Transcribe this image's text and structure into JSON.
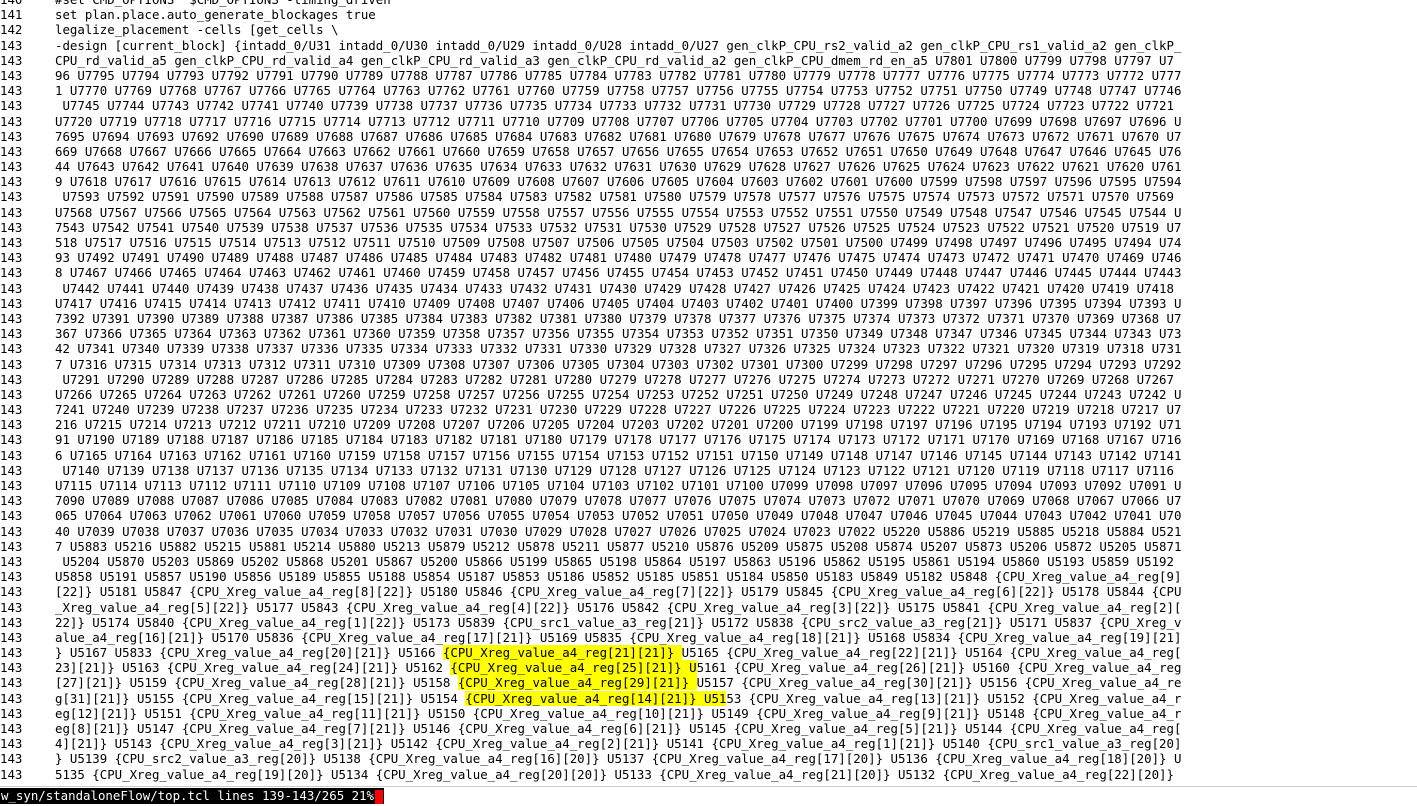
{
  "terminal": {
    "lines": [
      {
        "n": "140",
        "t": "#set CMD_OPTIONS \"$CMD_OPTIONS -timing_driven\""
      },
      {
        "n": "141",
        "t": "set plan.place.auto_generate_blockages true"
      },
      {
        "n": "142",
        "t": "legalize_placement -cells [get_cells \\"
      },
      {
        "n": "143",
        "t": "-design [current_block] {intadd_0/U31 intadd_0/U30 intadd_0/U29 intadd_0/U28 intadd_0/U27 gen_clkP_CPU_rs2_valid_a2 gen_clkP_CPU_rs1_valid_a2 gen_clkP_"
      },
      {
        "n": "143",
        "t": "CPU_rd_valid_a5 gen_clkP_CPU_rd_valid_a4 gen_clkP_CPU_rd_valid_a3 gen_clkP_CPU_rd_valid_a2 gen_clkP_CPU_dmem_rd_en_a5 U7801 U7800 U7799 U7798 U7797 U7"
      },
      {
        "n": "143",
        "t": "96 U7795 U7794 U7793 U7792 U7791 U7790 U7789 U7788 U7787 U7786 U7785 U7784 U7783 U7782 U7781 U7780 U7779 U7778 U7777 U7776 U7775 U7774 U7773 U7772 U777"
      },
      {
        "n": "143",
        "t": "1 U7770 U7769 U7768 U7767 U7766 U7765 U7764 U7763 U7762 U7761 U7760 U7759 U7758 U7757 U7756 U7755 U7754 U7753 U7752 U7751 U7750 U7749 U7748 U7747 U7746"
      },
      {
        "n": "143",
        "t": " U7745 U7744 U7743 U7742 U7741 U7740 U7739 U7738 U7737 U7736 U7735 U7734 U7733 U7732 U7731 U7730 U7729 U7728 U7727 U7726 U7725 U7724 U7723 U7722 U7721"
      },
      {
        "n": "143",
        "t": "U7720 U7719 U7718 U7717 U7716 U7715 U7714 U7713 U7712 U7711 U7710 U7709 U7708 U7707 U7706 U7705 U7704 U7703 U7702 U7701 U7700 U7699 U7698 U7697 U7696 U"
      },
      {
        "n": "143",
        "t": "7695 U7694 U7693 U7692 U7690 U7689 U7688 U7687 U7686 U7685 U7684 U7683 U7682 U7681 U7680 U7679 U7678 U7677 U7676 U7675 U7674 U7673 U7672 U7671 U7670 U7"
      },
      {
        "n": "143",
        "t": "669 U7668 U7667 U7666 U7665 U7664 U7663 U7662 U7661 U7660 U7659 U7658 U7657 U7656 U7655 U7654 U7653 U7652 U7651 U7650 U7649 U7648 U7647 U7646 U7645 U76"
      },
      {
        "n": "143",
        "t": "44 U7643 U7642 U7641 U7640 U7639 U7638 U7637 U7636 U7635 U7634 U7633 U7632 U7631 U7630 U7629 U7628 U7627 U7626 U7625 U7624 U7623 U7622 U7621 U7620 U761"
      },
      {
        "n": "143",
        "t": "9 U7618 U7617 U7616 U7615 U7614 U7613 U7612 U7611 U7610 U7609 U7608 U7607 U7606 U7605 U7604 U7603 U7602 U7601 U7600 U7599 U7598 U7597 U7596 U7595 U7594"
      },
      {
        "n": "143",
        "t": " U7593 U7592 U7591 U7590 U7589 U7588 U7587 U7586 U7585 U7584 U7583 U7582 U7581 U7580 U7579 U7578 U7577 U7576 U7575 U7574 U7573 U7572 U7571 U7570 U7569"
      },
      {
        "n": "143",
        "t": "U7568 U7567 U7566 U7565 U7564 U7563 U7562 U7561 U7560 U7559 U7558 U7557 U7556 U7555 U7554 U7553 U7552 U7551 U7550 U7549 U7548 U7547 U7546 U7545 U7544 U"
      },
      {
        "n": "143",
        "t": "7543 U7542 U7541 U7540 U7539 U7538 U7537 U7536 U7535 U7534 U7533 U7532 U7531 U7530 U7529 U7528 U7527 U7526 U7525 U7524 U7523 U7522 U7521 U7520 U7519 U7"
      },
      {
        "n": "143",
        "t": "518 U7517 U7516 U7515 U7514 U7513 U7512 U7511 U7510 U7509 U7508 U7507 U7506 U7505 U7504 U7503 U7502 U7501 U7500 U7499 U7498 U7497 U7496 U7495 U7494 U74"
      },
      {
        "n": "143",
        "t": "93 U7492 U7491 U7490 U7489 U7488 U7487 U7486 U7485 U7484 U7483 U7482 U7481 U7480 U7479 U7478 U7477 U7476 U7475 U7474 U7473 U7472 U7471 U7470 U7469 U746"
      },
      {
        "n": "143",
        "t": "8 U7467 U7466 U7465 U7464 U7463 U7462 U7461 U7460 U7459 U7458 U7457 U7456 U7455 U7454 U7453 U7452 U7451 U7450 U7449 U7448 U7447 U7446 U7445 U7444 U7443"
      },
      {
        "n": "143",
        "t": " U7442 U7441 U7440 U7439 U7438 U7437 U7436 U7435 U7434 U7433 U7432 U7431 U7430 U7429 U7428 U7427 U7426 U7425 U7424 U7423 U7422 U7421 U7420 U7419 U7418"
      },
      {
        "n": "143",
        "t": "U7417 U7416 U7415 U7414 U7413 U7412 U7411 U7410 U7409 U7408 U7407 U7406 U7405 U7404 U7403 U7402 U7401 U7400 U7399 U7398 U7397 U7396 U7395 U7394 U7393 U"
      },
      {
        "n": "143",
        "t": "7392 U7391 U7390 U7389 U7388 U7387 U7386 U7385 U7384 U7383 U7382 U7381 U7380 U7379 U7378 U7377 U7376 U7375 U7374 U7373 U7372 U7371 U7370 U7369 U7368 U7"
      },
      {
        "n": "143",
        "t": "367 U7366 U7365 U7364 U7363 U7362 U7361 U7360 U7359 U7358 U7357 U7356 U7355 U7354 U7353 U7352 U7351 U7350 U7349 U7348 U7347 U7346 U7345 U7344 U7343 U73"
      },
      {
        "n": "143",
        "t": "42 U7341 U7340 U7339 U7338 U7337 U7336 U7335 U7334 U7333 U7332 U7331 U7330 U7329 U7328 U7327 U7326 U7325 U7324 U7323 U7322 U7321 U7320 U7319 U7318 U731"
      },
      {
        "n": "143",
        "t": "7 U7316 U7315 U7314 U7313 U7312 U7311 U7310 U7309 U7308 U7307 U7306 U7305 U7304 U7303 U7302 U7301 U7300 U7299 U7298 U7297 U7296 U7295 U7294 U7293 U7292"
      },
      {
        "n": "143",
        "t": " U7291 U7290 U7289 U7288 U7287 U7286 U7285 U7284 U7283 U7282 U7281 U7280 U7279 U7278 U7277 U7276 U7275 U7274 U7273 U7272 U7271 U7270 U7269 U7268 U7267"
      },
      {
        "n": "143",
        "t": "U7266 U7265 U7264 U7263 U7262 U7261 U7260 U7259 U7258 U7257 U7256 U7255 U7254 U7253 U7252 U7251 U7250 U7249 U7248 U7247 U7246 U7245 U7244 U7243 U7242 U"
      },
      {
        "n": "143",
        "t": "7241 U7240 U7239 U7238 U7237 U7236 U7235 U7234 U7233 U7232 U7231 U7230 U7229 U7228 U7227 U7226 U7225 U7224 U7223 U7222 U7221 U7220 U7219 U7218 U7217 U7"
      },
      {
        "n": "143",
        "t": "216 U7215 U7214 U7213 U7212 U7211 U7210 U7209 U7208 U7207 U7206 U7205 U7204 U7203 U7202 U7201 U7200 U7199 U7198 U7197 U7196 U7195 U7194 U7193 U7192 U71"
      },
      {
        "n": "143",
        "t": "91 U7190 U7189 U7188 U7187 U7186 U7185 U7184 U7183 U7182 U7181 U7180 U7179 U7178 U7177 U7176 U7175 U7174 U7173 U7172 U7171 U7170 U7169 U7168 U7167 U716"
      },
      {
        "n": "143",
        "t": "6 U7165 U7164 U7163 U7162 U7161 U7160 U7159 U7158 U7157 U7156 U7155 U7154 U7153 U7152 U7151 U7150 U7149 U7148 U7147 U7146 U7145 U7144 U7143 U7142 U7141"
      },
      {
        "n": "143",
        "t": " U7140 U7139 U7138 U7137 U7136 U7135 U7134 U7133 U7132 U7131 U7130 U7129 U7128 U7127 U7126 U7125 U7124 U7123 U7122 U7121 U7120 U7119 U7118 U7117 U7116"
      },
      {
        "n": "143",
        "t": "U7115 U7114 U7113 U7112 U7111 U7110 U7109 U7108 U7107 U7106 U7105 U7104 U7103 U7102 U7101 U7100 U7099 U7098 U7097 U7096 U7095 U7094 U7093 U7092 U7091 U"
      },
      {
        "n": "143",
        "t": "7090 U7089 U7088 U7087 U7086 U7085 U7084 U7083 U7082 U7081 U7080 U7079 U7078 U7077 U7076 U7075 U7074 U7073 U7072 U7071 U7070 U7069 U7068 U7067 U7066 U7"
      },
      {
        "n": "143",
        "t": "065 U7064 U7063 U7062 U7061 U7060 U7059 U7058 U7057 U7056 U7055 U7054 U7053 U7052 U7051 U7050 U7049 U7048 U7047 U7046 U7045 U7044 U7043 U7042 U7041 U70"
      },
      {
        "n": "143",
        "t": "40 U7039 U7038 U7037 U7036 U7035 U7034 U7033 U7032 U7031 U7030 U7029 U7028 U7027 U7026 U7025 U7024 U7023 U7022 U5220 U5886 U5219 U5885 U5218 U5884 U521"
      },
      {
        "n": "143",
        "t": "7 U5883 U5216 U5882 U5215 U5881 U5214 U5880 U5213 U5879 U5212 U5878 U5211 U5877 U5210 U5876 U5209 U5875 U5208 U5874 U5207 U5873 U5206 U5872 U5205 U5871"
      },
      {
        "n": "143",
        "t": " U5204 U5870 U5203 U5869 U5202 U5868 U5201 U5867 U5200 U5866 U5199 U5865 U5198 U5864 U5197 U5863 U5196 U5862 U5195 U5861 U5194 U5860 U5193 U5859 U5192"
      },
      {
        "n": "143",
        "t": "U5858 U5191 U5857 U5190 U5856 U5189 U5855 U5188 U5854 U5187 U5853 U5186 U5852 U5185 U5851 U5184 U5850 U5183 U5849 U5182 U5848 {CPU_Xreg_value_a4_reg[9]"
      },
      {
        "n": "143",
        "t": "[22]} U5181 U5847 {CPU_Xreg_value_a4_reg[8][22]} U5180 U5846 {CPU_Xreg_value_a4_reg[7][22]} U5179 U5845 {CPU_Xreg_value_a4_reg[6][22]} U5178 U5844 {CPU"
      },
      {
        "n": "143",
        "t": "_Xreg_value_a4_reg[5][22]} U5177 U5843 {CPU_Xreg_value_a4_reg[4][22]} U5176 U5842 {CPU_Xreg_value_a4_reg[3][22]} U5175 U5841 {CPU_Xreg_value_a4_reg[2]["
      },
      {
        "n": "143",
        "t": "22]} U5174 U5840 {CPU_Xreg_value_a4_reg[1][22]} U5173 U5839 {CPU_src1_value_a3_reg[21]} U5172 U5838 {CPU_src2_value_a3_reg[21]} U5171 U5837 {CPU_Xreg_v"
      },
      {
        "n": "143",
        "t": "alue_a4_reg[16][21]} U5170 U5836 {CPU_Xreg_value_a4_reg[17][21]} U5169 U5835 {CPU_Xreg_value_a4_reg[18][21]} U5168 U5834 {CPU_Xreg_value_a4_reg[19][21]"
      },
      {
        "n": "143",
        "pre": "} U5167 U5833 {CPU_Xreg_value_a4_reg[20][21]} U5166 ",
        "hl": "{CPU_Xreg_value_a4_reg[21][21]} ",
        "post": "U5165 {CPU_Xreg_value_a4_reg[22][21]} U5164 {CPU_Xreg_value_a4_reg["
      },
      {
        "n": "143",
        "pre": "23][21]} U5163 {CPU_Xreg_value_a4_reg[24][21]} U5162 ",
        "hl": "{CPU_Xreg_value_a4_reg[25][21]} U",
        "post": "5161 {CPU_Xreg_value_a4_reg[26][21]} U5160 {CPU_Xreg_value_a4_reg"
      },
      {
        "n": "143",
        "pre": "[27][21]} U5159 {CPU_Xreg_value_a4_reg[28][21]} U5158 ",
        "hl": "{CPU_Xreg_value_a4_reg[29][21]} ",
        "post": "U5157 {CPU_Xreg_value_a4_reg[30][21]} U5156 {CPU_Xreg_value_a4_re"
      },
      {
        "n": "143",
        "pre": "g[31][21]} U5155 {CPU_Xreg_value_a4_reg[15][21]} U5154 ",
        "hl": "{CPU_Xreg_value_a4_reg[14][21]} U51",
        "post": "53 {CPU_Xreg_value_a4_reg[13][21]} U5152 {CPU_Xreg_value_a4_r"
      },
      {
        "n": "143",
        "t": "eg[12][21]} U5151 {CPU_Xreg_value_a4_reg[11][21]} U5150 {CPU_Xreg_value_a4_reg[10][21]} U5149 {CPU_Xreg_value_a4_reg[9][21]} U5148 {CPU_Xreg_value_a4_r"
      },
      {
        "n": "143",
        "t": "eg[8][21]} U5147 {CPU_Xreg_value_a4_reg[7][21]} U5146 {CPU_Xreg_value_a4_reg[6][21]} U5145 {CPU_Xreg_value_a4_reg[5][21]} U5144 {CPU_Xreg_value_a4_reg["
      },
      {
        "n": "143",
        "t": "4][21]} U5143 {CPU_Xreg_value_a4_reg[3][21]} U5142 {CPU_Xreg_value_a4_reg[2][21]} U5141 {CPU_Xreg_value_a4_reg[1][21]} U5140 {CPU_src1_value_a3_reg[20]"
      },
      {
        "n": "143",
        "t": "} U5139 {CPU_src2_value_a3_reg[20]} U5138 {CPU_Xreg_value_a4_reg[16][20]} U5137 {CPU_Xreg_value_a4_reg[17][20]} U5136 {CPU_Xreg_value_a4_reg[18][20]} U"
      },
      {
        "n": "143",
        "t": "5135 {CPU_Xreg_value_a4_reg[19][20]} U5134 {CPU_Xreg_value_a4_reg[20][20]} U5133 {CPU_Xreg_value_a4_reg[21][20]} U5132 {CPU_Xreg_value_a4_reg[22][20]}"
      }
    ]
  },
  "status": {
    "text": "w_syn/standaloneFlow/top.tcl lines 139-143/265 21%"
  },
  "colors": {
    "highlight": "#ffff00",
    "cursor": "#ff0000",
    "statusbar_bg": "#000000",
    "statusbar_fg": "#ffffff"
  }
}
